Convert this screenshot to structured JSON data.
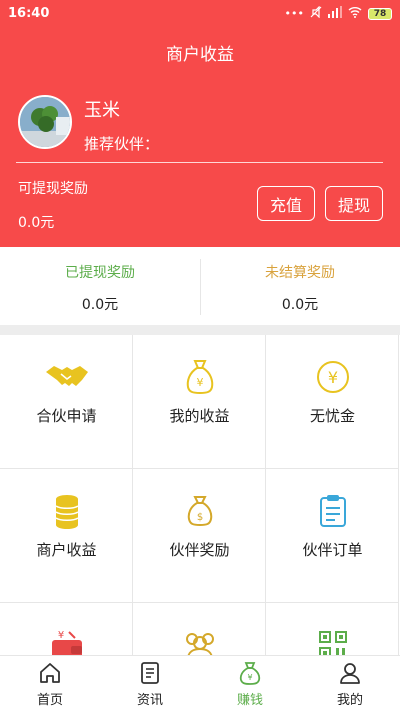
{
  "status_bar": {
    "time": "16:40",
    "battery": "78"
  },
  "header": {
    "title": "商户收益"
  },
  "user": {
    "name": "玉米",
    "referrer_label": "推荐伙伴："
  },
  "withdrawable": {
    "label": "可提现奖励",
    "amount": "0.0元"
  },
  "actions": {
    "recharge": "充值",
    "withdraw": "提现"
  },
  "summary": {
    "withdrawn_label": "已提现奖励",
    "withdrawn_value": "0.0元",
    "unsettled_label": "未结算奖励",
    "unsettled_value": "0.0元"
  },
  "grid": [
    {
      "label": "合伙申请",
      "icon": "handshake-icon"
    },
    {
      "label": "我的收益",
      "icon": "money-bag-icon"
    },
    {
      "label": "无忧金",
      "icon": "yen-coin-icon"
    },
    {
      "label": "商户收益",
      "icon": "coin-stack-icon"
    },
    {
      "label": "伙伴奖励",
      "icon": "dollar-bag-icon"
    },
    {
      "label": "伙伴订单",
      "icon": "clipboard-icon"
    },
    {
      "label": "",
      "icon": "wallet-icon"
    },
    {
      "label": "",
      "icon": "team-icon"
    },
    {
      "label": "",
      "icon": "qrcode-icon"
    }
  ],
  "tabs": [
    {
      "label": "首页",
      "icon": "home-icon"
    },
    {
      "label": "资讯",
      "icon": "news-icon"
    },
    {
      "label": "赚钱",
      "icon": "money-bag-icon",
      "active": true
    },
    {
      "label": "我的",
      "icon": "user-icon"
    }
  ],
  "colors": {
    "accent_red": "#f74a4a",
    "green": "#5cad4a",
    "gold": "#e8c320",
    "orange": "#d9a23c"
  }
}
